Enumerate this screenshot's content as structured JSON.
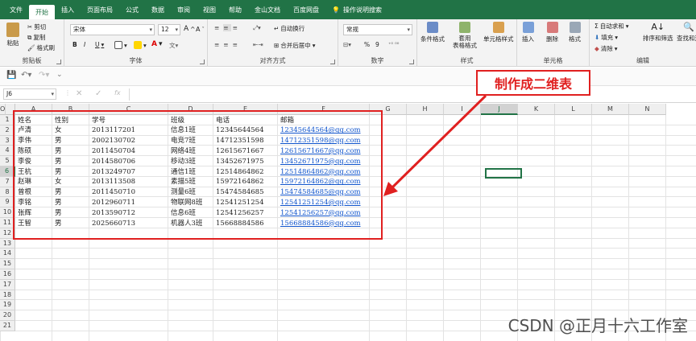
{
  "tabs": [
    "文件",
    "开始",
    "插入",
    "页面布局",
    "公式",
    "数据",
    "审阅",
    "视图",
    "帮助",
    "金山文档",
    "百度网盘",
    "操作说明搜索"
  ],
  "ribbon": {
    "clipboard": {
      "label": "剪贴板",
      "paste": "粘贴",
      "cut": "剪切",
      "copy": "复制",
      "painter": "格式刷"
    },
    "font": {
      "label": "字体",
      "name": "宋体",
      "size": "12",
      "bold": "B",
      "italic": "I",
      "underline": "U",
      "grow": "A",
      "shrink": "A",
      "color_char": "A"
    },
    "align": {
      "label": "对齐方式",
      "wrap": "自动换行",
      "merge": "合并后居中"
    },
    "number": {
      "label": "数字",
      "format": "常规",
      "percent": "%",
      "comma": "9"
    },
    "styles": {
      "label": "样式",
      "cond": "条件格式",
      "table": "套用\n表格格式",
      "cell": "单元格样式"
    },
    "cells": {
      "label": "单元格",
      "insert": "插入",
      "delete": "删除",
      "format": "格式"
    },
    "editing": {
      "label": "编辑",
      "autosum": "自动求和",
      "fill": "填充",
      "clear": "清除",
      "sort": "排序和筛选",
      "find": "查找和选"
    }
  },
  "namebox": "J6",
  "fx": "fx",
  "columns": [
    "A",
    "B",
    "C",
    "D",
    "E",
    "F",
    "G",
    "H",
    "I",
    "J",
    "K",
    "L",
    "M",
    "N",
    "O"
  ],
  "rows": [
    "1",
    "2",
    "3",
    "4",
    "5",
    "6",
    "7",
    "8",
    "9",
    "10",
    "11",
    "12",
    "13",
    "14",
    "15",
    "16",
    "17",
    "18",
    "19",
    "20",
    "21"
  ],
  "table": {
    "headers": [
      "姓名",
      "性别",
      "学号",
      "班级",
      "电话",
      "邮箱"
    ],
    "data": [
      [
        "卢清",
        "女",
        "2013117201",
        "信息1班",
        "12345644564",
        "12345644564@qq.com"
      ],
      [
        "李伟",
        "男",
        "2002130702",
        "电竞7班",
        "14712351598",
        "14712351598@qq.com"
      ],
      [
        "陈硕",
        "男",
        "2011450704",
        "网络4班",
        "12615671667",
        "12615671667@qq.com"
      ],
      [
        "李俊",
        "男",
        "2014580706",
        "移动3班",
        "13452671975",
        "13452671975@qq.com"
      ],
      [
        "王杭",
        "男",
        "2013249707",
        "通信1班",
        "12514864862",
        "12514864862@qq.com"
      ],
      [
        "赵琳",
        "女",
        "2013113508",
        "素描5班",
        "15972164862",
        "15972164862@qq.com"
      ],
      [
        "曾根",
        "男",
        "2011450710",
        "测量6班",
        "15474584685",
        "15474584685@qq.com"
      ],
      [
        "李铭",
        "男",
        "2012960711",
        "物联网8班",
        "12541251254",
        "12541251254@qq.com"
      ],
      [
        "张辉",
        "男",
        "2013590712",
        "信息6班",
        "12541256257",
        "12541256257@qq.com"
      ],
      [
        "王智",
        "男",
        "2025660713",
        "机器人3班",
        "15668884586",
        "15668884586@qq.com"
      ]
    ]
  },
  "callout": "制作成二维表",
  "watermark": "CSDN @正月十六工作室",
  "colors": {
    "excel_green": "#217346",
    "annotation_red": "#e02020",
    "link": "#1155cc"
  }
}
